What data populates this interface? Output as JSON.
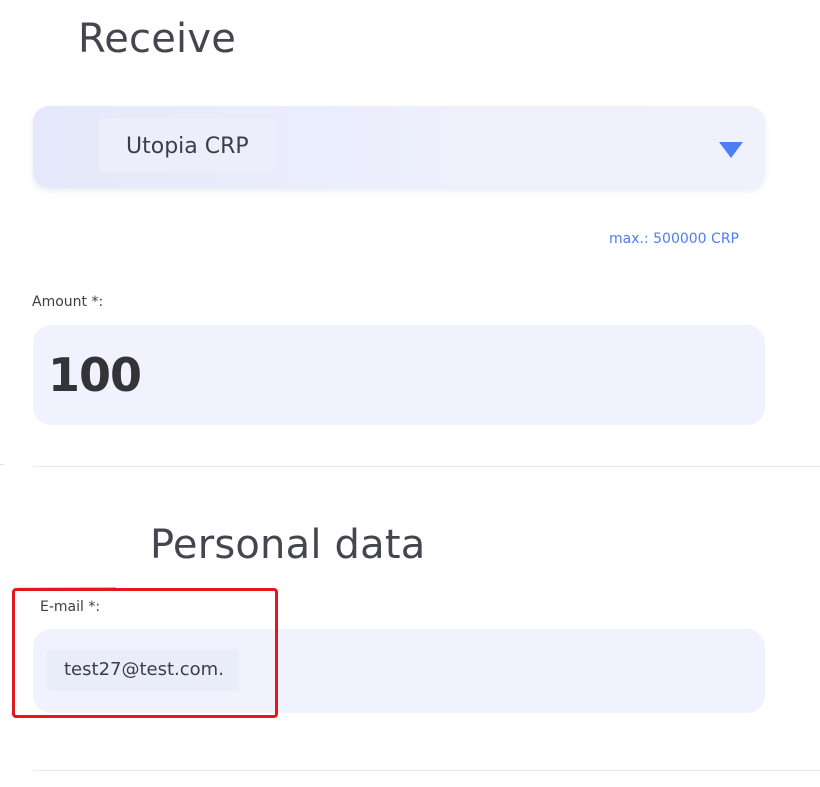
{
  "receive": {
    "title": "Receive",
    "currency_select": {
      "selected": "Utopia CRP",
      "arrow_icon": "caret-down-icon",
      "arrow_color": "#4d7ef2"
    },
    "max_hint": "max.: 500000 CRP"
  },
  "amount": {
    "label": "Amount *:",
    "value": "100"
  },
  "personal": {
    "title": "Personal data",
    "email_label": "E-mail *:",
    "email_value": "test27@test.com."
  },
  "colors": {
    "accent": "#4d7ef2",
    "highlight": "#e2181c",
    "field_bg": "#f0f2fd"
  }
}
